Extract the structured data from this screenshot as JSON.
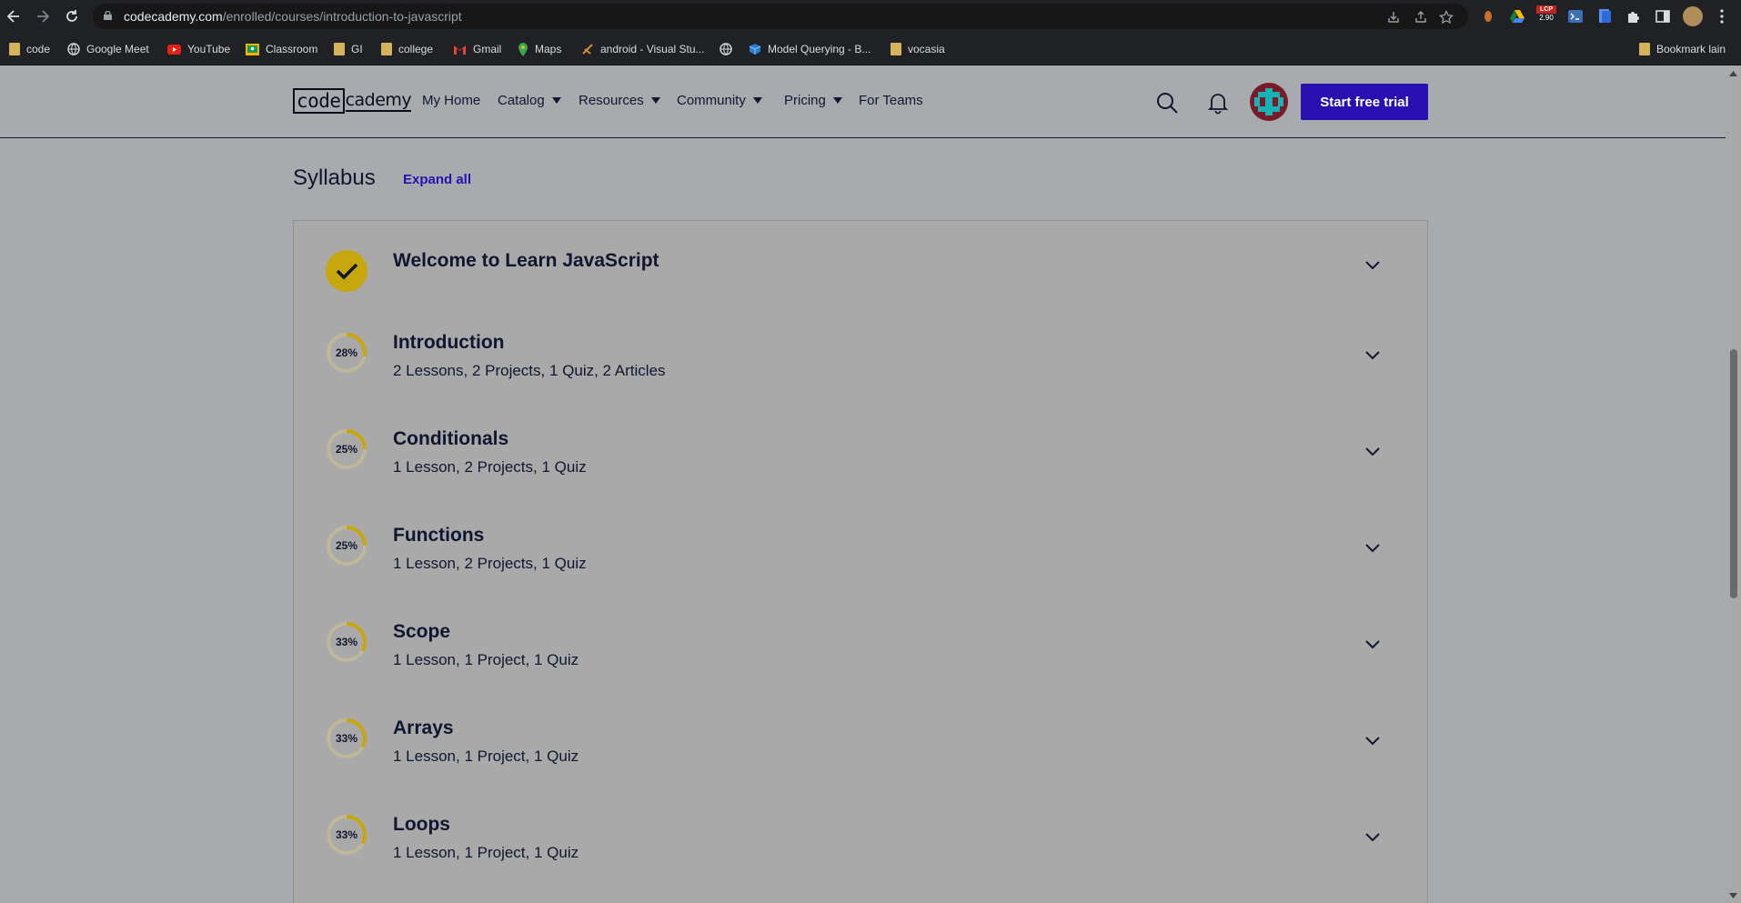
{
  "browser": {
    "url_host": "codecademy.com",
    "url_path": "/enrolled/courses/introduction-to-javascript",
    "extension_badge": "2.90"
  },
  "bookmarks": [
    {
      "label": "code",
      "icon": "folder-icon"
    },
    {
      "label": "Google Meet",
      "icon": "globe-icon"
    },
    {
      "label": "YouTube",
      "icon": "youtube-icon"
    },
    {
      "label": "Classroom",
      "icon": "classroom-icon"
    },
    {
      "label": "GI",
      "icon": "folder-icon"
    },
    {
      "label": "college",
      "icon": "folder-icon"
    },
    {
      "label": "Gmail",
      "icon": "gmail-icon"
    },
    {
      "label": "Maps",
      "icon": "maps-icon"
    },
    {
      "label": "android - Visual Stu...",
      "icon": "visual-studio-icon"
    },
    {
      "label": "",
      "icon": "globe-icon"
    },
    {
      "label": "Model Querying - B...",
      "icon": "cube-icon"
    },
    {
      "label": "vocasia",
      "icon": "folder-icon"
    },
    {
      "label": "Bookmark lain",
      "icon": "folder-icon"
    }
  ],
  "header": {
    "logo_code": "code",
    "logo_rest": "cademy",
    "nav": [
      "My Home",
      "Catalog",
      "Resources",
      "Community",
      "Pricing",
      "For Teams"
    ],
    "trial_button": "Start free trial"
  },
  "syllabus": {
    "title": "Syllabus",
    "expand_all": "Expand all",
    "modules": [
      {
        "title": "Welcome to Learn JavaScript",
        "summary": "",
        "progress": "",
        "completed": true
      },
      {
        "title": "Introduction",
        "summary": "2 Lessons, 2 Projects, 1 Quiz, 2 Articles",
        "progress": "28%",
        "fraction": 0.28
      },
      {
        "title": "Conditionals",
        "summary": "1 Lesson, 2 Projects, 1 Quiz",
        "progress": "25%",
        "fraction": 0.25
      },
      {
        "title": "Functions",
        "summary": "1 Lesson, 2 Projects, 1 Quiz",
        "progress": "25%",
        "fraction": 0.25
      },
      {
        "title": "Scope",
        "summary": "1 Lesson, 1 Project, 1 Quiz",
        "progress": "33%",
        "fraction": 0.33
      },
      {
        "title": "Arrays",
        "summary": "1 Lesson, 1 Project, 1 Quiz",
        "progress": "33%",
        "fraction": 0.33
      },
      {
        "title": "Loops",
        "summary": "1 Lesson, 1 Project, 1 Quiz",
        "progress": "33%",
        "fraction": 0.33
      }
    ]
  },
  "colors": {
    "accent": "#2a10b0",
    "progress_ring": "#c7a70e",
    "progress_track": "#bfb79a"
  }
}
